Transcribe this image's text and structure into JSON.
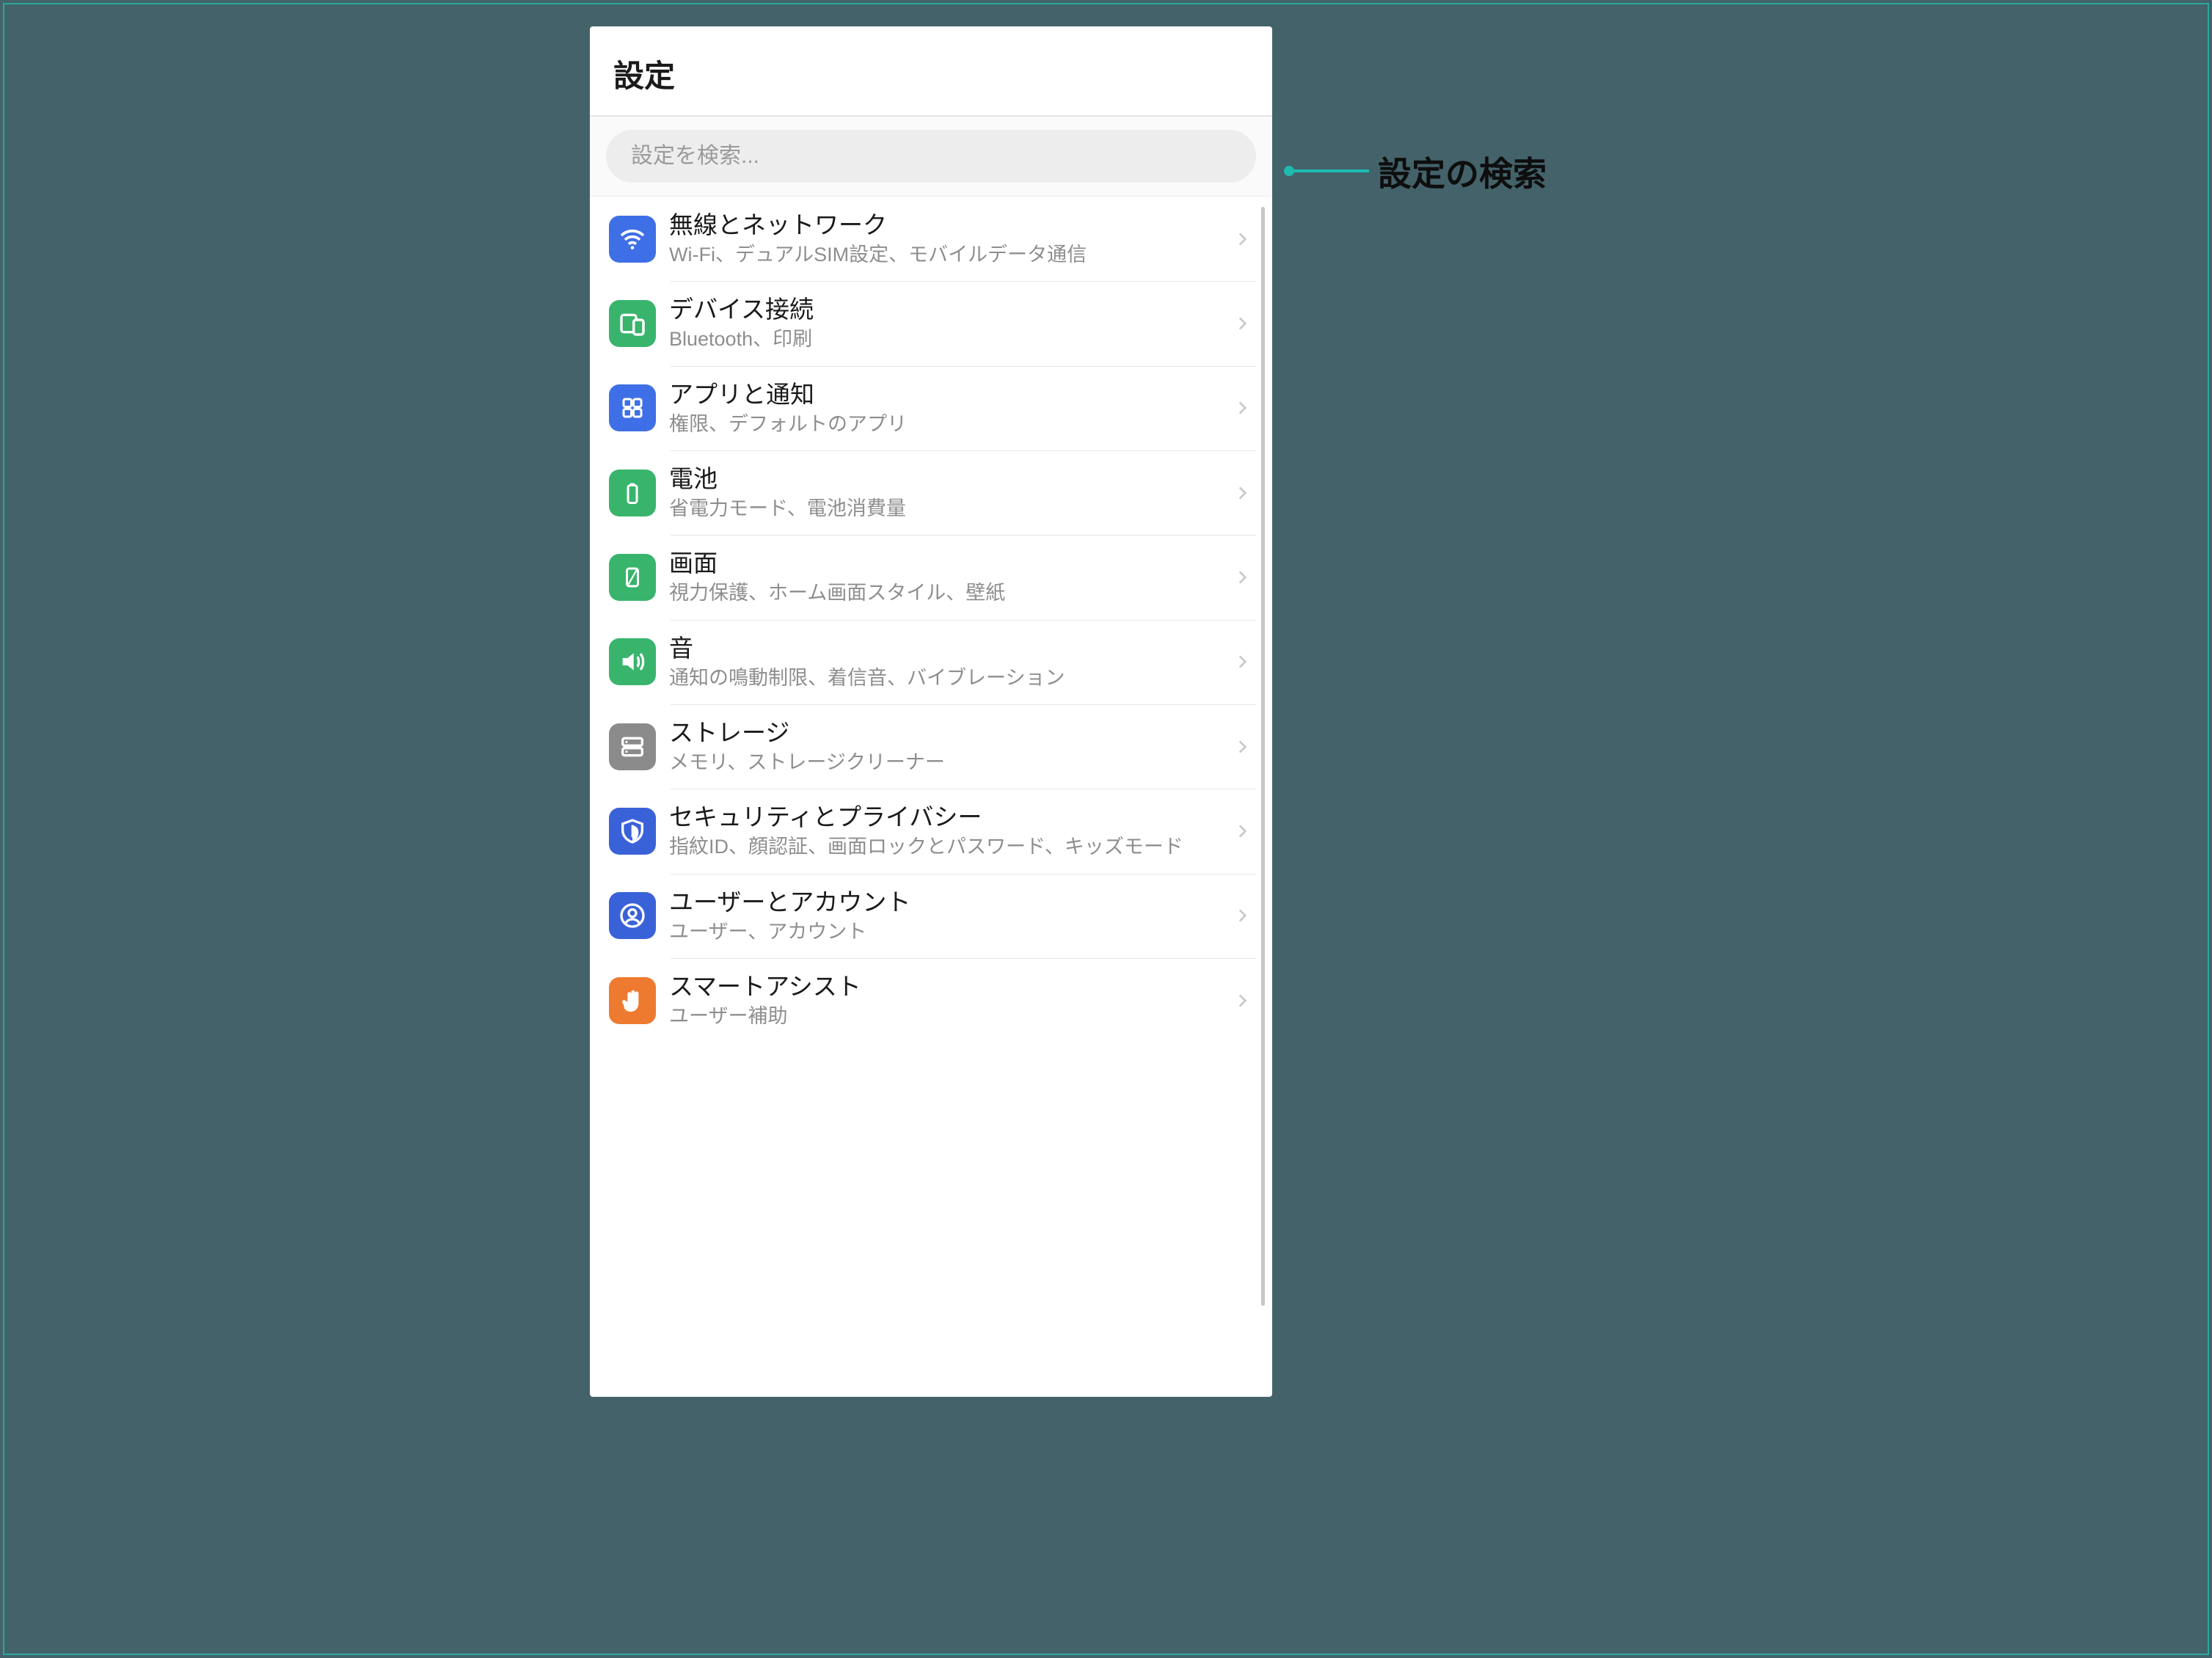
{
  "header": {
    "title": "設定"
  },
  "search": {
    "placeholder": "設定を検索..."
  },
  "callout": {
    "label": "設定の検索"
  },
  "items": [
    {
      "id": "wireless",
      "title": "無線とネットワーク",
      "subtitle": "Wi-Fi、デュアルSIM設定、モバイルデータ通信",
      "color": "blue",
      "icon": "wifi"
    },
    {
      "id": "device",
      "title": "デバイス接続",
      "subtitle": "Bluetooth、印刷",
      "color": "green",
      "icon": "devices"
    },
    {
      "id": "apps",
      "title": "アプリと通知",
      "subtitle": "権限、デフォルトのアプリ",
      "color": "blue",
      "icon": "apps"
    },
    {
      "id": "battery",
      "title": "電池",
      "subtitle": "省電力モード、電池消費量",
      "color": "green",
      "icon": "battery"
    },
    {
      "id": "display",
      "title": "画面",
      "subtitle": "視力保護、ホーム画面スタイル、壁紙",
      "color": "green",
      "icon": "display"
    },
    {
      "id": "sound",
      "title": "音",
      "subtitle": "通知の鳴動制限、着信音、バイブレーション",
      "color": "green",
      "icon": "sound"
    },
    {
      "id": "storage",
      "title": "ストレージ",
      "subtitle": "メモリ、ストレージクリーナー",
      "color": "gray",
      "icon": "storage"
    },
    {
      "id": "security",
      "title": "セキュリティとプライバシー",
      "subtitle": "指紋ID、顔認証、画面ロックとパスワード、キッズモード",
      "color": "blue2",
      "icon": "shield"
    },
    {
      "id": "accounts",
      "title": "ユーザーとアカウント",
      "subtitle": "ユーザー、アカウント",
      "color": "blue2",
      "icon": "user"
    },
    {
      "id": "smart",
      "title": "スマートアシスト",
      "subtitle": "ユーザー補助",
      "color": "orange",
      "icon": "hand"
    }
  ]
}
